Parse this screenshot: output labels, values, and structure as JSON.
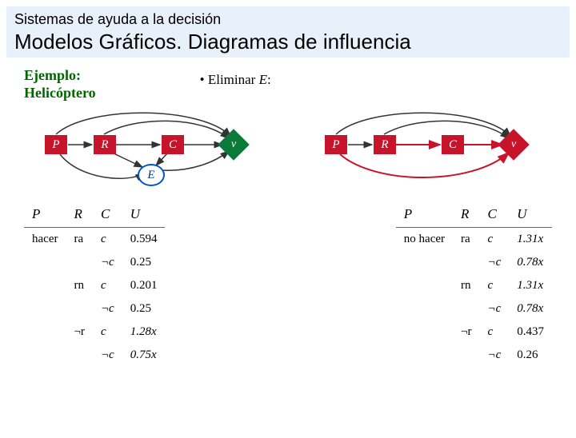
{
  "header": {
    "subtitle": "Sistemas de ayuda a la decisión",
    "title": "Modelos Gráficos. Diagramas de influencia"
  },
  "example": {
    "line1": "Ejemplo:",
    "line2": "Helicóptero"
  },
  "bullet": {
    "prefix": "• Eliminar ",
    "var": "E",
    "suffix": ":"
  },
  "nodes": {
    "P": "P",
    "R": "R",
    "C": "C",
    "E": "E",
    "v": "v"
  },
  "tables": {
    "headers": [
      "P",
      "R",
      "C",
      "U"
    ],
    "left": [
      {
        "P": "hacer",
        "R": "ra",
        "C": "c",
        "U": "0.594"
      },
      {
        "P": "",
        "R": "",
        "C": "¬c",
        "U": "0.25"
      },
      {
        "P": "",
        "R": "rn",
        "C": "c",
        "U": "0.201"
      },
      {
        "P": "",
        "R": "",
        "C": "¬c",
        "U": "0.25"
      },
      {
        "P": "",
        "R": "¬r",
        "C": "c",
        "U": "1.28x"
      },
      {
        "P": "",
        "R": "",
        "C": "¬c",
        "U": "0.75x"
      }
    ],
    "right": [
      {
        "P": "no hacer",
        "R": "ra",
        "C": "c",
        "U": "1.31x"
      },
      {
        "P": "",
        "R": "",
        "C": "¬c",
        "U": "0.78x"
      },
      {
        "P": "",
        "R": "rn",
        "C": "c",
        "U": "1.31x"
      },
      {
        "P": "",
        "R": "",
        "C": "¬c",
        "U": "0.78x"
      },
      {
        "P": "",
        "R": "¬r",
        "C": "c",
        "U": "0.437"
      },
      {
        "P": "",
        "R": "",
        "C": "¬c",
        "U": "0.26"
      }
    ]
  }
}
